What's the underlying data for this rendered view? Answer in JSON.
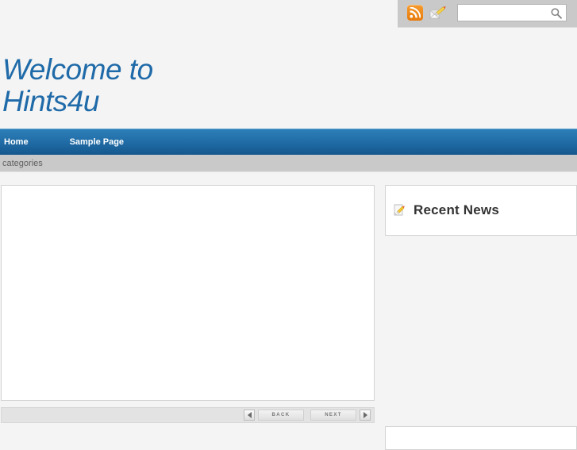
{
  "page": {
    "background_color": "#f4f4f4",
    "accent_color": "#1f6aa8",
    "nav_color": "#1f6aa4"
  },
  "toolbar": {
    "rss_icon": "rss-icon",
    "contact_icon": "envelope-pencil-icon",
    "search": {
      "value": "",
      "placeholder": "",
      "icon": "search-icon"
    }
  },
  "header": {
    "title_line1": "Welcome to",
    "title_line2": "Hints4u"
  },
  "nav": {
    "items": [
      {
        "label": "Home"
      },
      {
        "label": "Sample Page"
      }
    ]
  },
  "categories_bar": {
    "label": "categories"
  },
  "main": {
    "content": ""
  },
  "pager": {
    "prev_arrow": "triangle-left-icon",
    "back_label": "BACK",
    "next_label": "NEXT",
    "next_arrow": "triangle-right-icon"
  },
  "sidebar": {
    "widgets": [
      {
        "icon": "note-pencil-icon",
        "title": "Recent News",
        "items": []
      }
    ]
  }
}
